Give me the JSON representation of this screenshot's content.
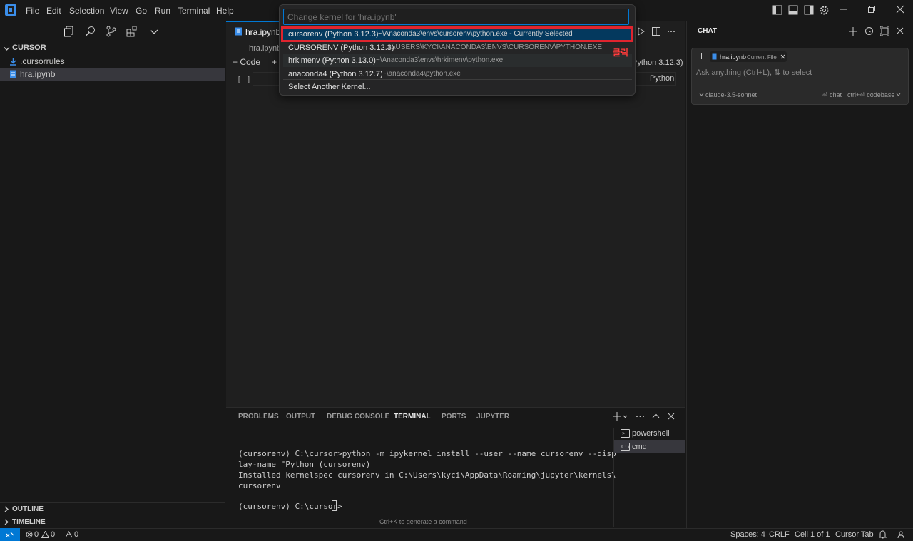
{
  "menu": [
    "File",
    "Edit",
    "Selection",
    "View",
    "Go",
    "Run",
    "Terminal",
    "Help"
  ],
  "sidebar": {
    "title": "CURSOR",
    "items": [
      {
        "label": ".cursorrules"
      },
      {
        "label": "hra.ipynb"
      }
    ],
    "sections": [
      "OUTLINE",
      "TIMELINE"
    ]
  },
  "editor": {
    "tab_label": "hra.ipynb",
    "breadcrumb": "hra.ipynb",
    "add_code": "Code",
    "kernel": "Python 3.12.3)",
    "cell_bracket": "[ ]",
    "cell_language": "Python"
  },
  "quickpick": {
    "placeholder": "Change kernel for 'hra.ipynb'",
    "items": [
      {
        "name": "cursorenv (Python 3.12.3)",
        "detail": "~\\Anaconda3\\envs\\cursorenv\\python.exe - Currently Selected"
      },
      {
        "name": "CURSORENV (Python 3.12.3)",
        "detail": "c:\\USERS\\KYCI\\ANACONDA3\\ENVS\\CURSORENV\\PYTHON.EXE"
      },
      {
        "name": "hrkimenv (Python 3.13.0)",
        "detail": "~\\Anaconda3\\envs\\hrkimenv\\python.exe"
      },
      {
        "name": "anaconda4 (Python 3.12.7)",
        "detail": "~\\anaconda4\\python.exe"
      },
      {
        "name": "Select Another Kernel...",
        "detail": ""
      }
    ],
    "annotation": "클릭"
  },
  "panel": {
    "tabs": [
      "PROBLEMS",
      "OUTPUT",
      "DEBUG CONSOLE",
      "TERMINAL",
      "PORTS",
      "JUPYTER"
    ],
    "terminal_lines": [
      "(cursorenv) C:\\cursor>python -m ipykernel install --user --name cursorenv --disp",
      "lay-name \"Python (cursorenv)",
      "Installed kernelspec cursorenv in C:\\Users\\kyci\\AppData\\Roaming\\jupyter\\kernels\\",
      "cursorenv",
      "",
      "(cursorenv) C:\\cursor>"
    ],
    "hint": "Ctrl+K to generate a command",
    "terminals": [
      "powershell",
      "cmd"
    ]
  },
  "chat": {
    "title": "CHAT",
    "file_chip": "hra.ipynb",
    "file_chip_tag": "Current File",
    "placeholder": "Ask anything (Ctrl+L), ⇅ to select",
    "model": "claude-3.5-sonnet",
    "chat_btn": "⏎ chat",
    "codebase_btn": "ctrl+⏎ codebase"
  },
  "status": {
    "errors": "0",
    "warnings": "0",
    "ports": "0",
    "spaces": "Spaces: 4",
    "eol": "CRLF",
    "cell": "Cell 1 of 1",
    "cursor_tab": "Cursor Tab"
  },
  "colors": {
    "accent": "#0078d4",
    "selected": "#04395e",
    "highlight": "#e0242e"
  }
}
